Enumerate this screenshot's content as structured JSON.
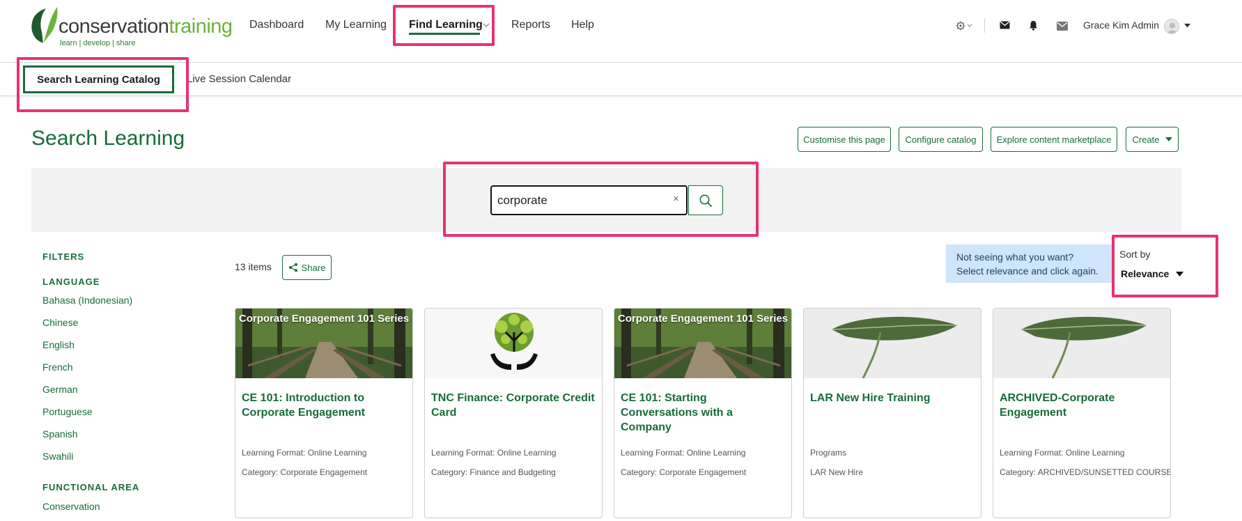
{
  "brand": {
    "name_part1": "conservation",
    "name_part2": "training",
    "tagline": "learn | develop | share"
  },
  "nav": {
    "items": [
      {
        "label": "Dashboard"
      },
      {
        "label": "My Learning"
      },
      {
        "label": "Find Learning"
      },
      {
        "label": "Reports"
      },
      {
        "label": "Help"
      }
    ],
    "user_name": "Grace Kim Admin"
  },
  "subnav": {
    "tabs": [
      {
        "label": "Search Learning Catalog"
      },
      {
        "label": "Live Session Calendar"
      }
    ]
  },
  "page": {
    "title": "Search Learning",
    "actions": {
      "customise": "Customise this page",
      "configure": "Configure catalog",
      "explore": "Explore content marketplace",
      "create": "Create"
    }
  },
  "search": {
    "value": "corporate",
    "clear_glyph": "×"
  },
  "filters": {
    "heading": "FILTERS",
    "sections": [
      {
        "title": "LANGUAGE",
        "items": [
          "Bahasa (Indonesian)",
          "Chinese",
          "English",
          "French",
          "German",
          "Portuguese",
          "Spanish",
          "Swahili"
        ]
      },
      {
        "title": "FUNCTIONAL AREA",
        "items": [
          "Conservation"
        ]
      }
    ]
  },
  "results": {
    "count_text": "13 items",
    "share_label": "Share",
    "hint_line1": "Not seeing what you want?",
    "hint_line2": "Select relevance and click again.",
    "sort_label": "Sort by",
    "sort_value": "Relevance"
  },
  "cards": [
    {
      "image": "forest-bridge",
      "image_caption": "Corporate Engagement 101 Series",
      "title": "CE 101: Introduction to Corporate Engagement",
      "meta1": "Learning Format: Online Learning",
      "meta2": "Category: Corporate Engagement"
    },
    {
      "image": "tree-hands-logo",
      "title": "TNC Finance: Corporate Credit Card",
      "meta1": "Learning Format: Online Learning",
      "meta2": "Category: Finance and Budgeting"
    },
    {
      "image": "forest-bridge",
      "image_caption": "Corporate Engagement 101 Series",
      "title": "CE 101: Starting Conversations with a Company",
      "meta1": "Learning Format: Online Learning",
      "meta2": "Category: Corporate Engagement"
    },
    {
      "image": "leaf",
      "title": "LAR New Hire Training",
      "meta1": "Programs",
      "meta2": "LAR New Hire"
    },
    {
      "image": "leaf",
      "title": "ARCHIVED-Corporate Engagement",
      "meta1": "Learning Format: Online Learning",
      "meta2": "Category: ARCHIVED/SUNSETTED COURSES"
    }
  ],
  "colors": {
    "brand_green": "#186b3a",
    "highlight": "#e8336d",
    "hint_bg": "#cfe5fb"
  }
}
